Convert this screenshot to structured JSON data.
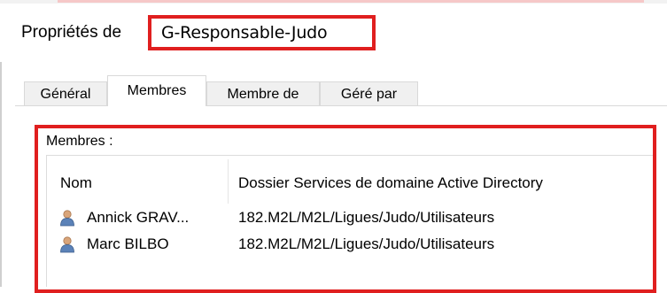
{
  "window": {
    "title_prefix": "Propriétés de",
    "group_name": "G-Responsable-Judo"
  },
  "tabs": [
    {
      "label": "Général",
      "active": false
    },
    {
      "label": "Membres",
      "active": true
    },
    {
      "label": "Membre de",
      "active": false
    },
    {
      "label": "Géré par",
      "active": false
    }
  ],
  "members_panel": {
    "label": "Membres :",
    "columns": {
      "name": "Nom",
      "folder": "Dossier Services de domaine Active Directory"
    },
    "rows": [
      {
        "name": "Annick GRAV...",
        "folder": "182.M2L/M2L/Ligues/Judo/Utilisateurs",
        "icon": "user-icon"
      },
      {
        "name": "Marc BILBO",
        "folder": "182.M2L/M2L/Ligues/Judo/Utilisateurs",
        "icon": "user-icon"
      }
    ]
  },
  "colors": {
    "highlight_red": "#e01f1f",
    "tab_border": "#d9d9d9",
    "inactive_tab_bg": "#f0f0f0",
    "user_icon_head": "#d9a57a",
    "user_icon_body": "#5b82b8"
  }
}
